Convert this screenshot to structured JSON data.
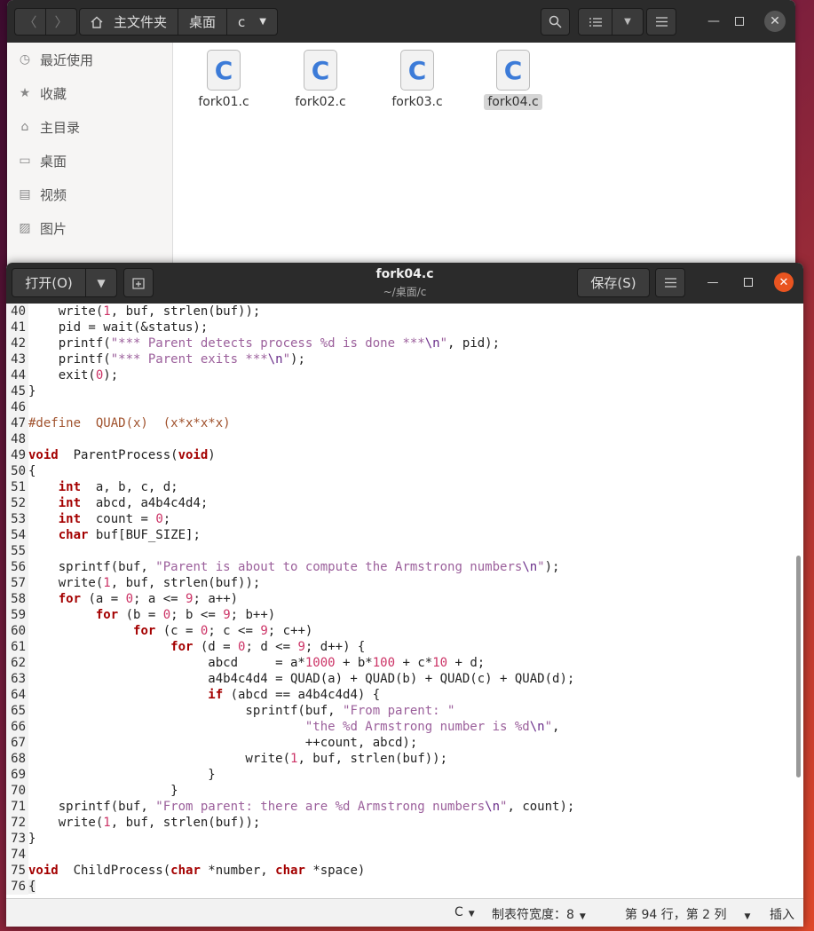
{
  "file_manager": {
    "path": [
      "主文件夹",
      "桌面",
      "c"
    ],
    "sidebar": [
      {
        "icon": "clock-icon",
        "label": "最近使用"
      },
      {
        "icon": "star-icon",
        "label": "收藏"
      },
      {
        "icon": "home-icon",
        "label": "主目录"
      },
      {
        "icon": "desktop-icon",
        "label": "桌面"
      },
      {
        "icon": "video-icon",
        "label": "视频"
      },
      {
        "icon": "picture-icon",
        "label": "图片"
      }
    ],
    "files": [
      {
        "name": "fork01.c",
        "icon_letter": "C"
      },
      {
        "name": "fork02.c",
        "icon_letter": "C"
      },
      {
        "name": "fork03.c",
        "icon_letter": "C"
      },
      {
        "name": "fork04.c",
        "icon_letter": "C",
        "selected": true
      }
    ]
  },
  "editor": {
    "open_label": "打开(O)",
    "title": "fork04.c",
    "subtitle": "~/桌面/c",
    "save_label": "保存(S)",
    "status": {
      "language": "C",
      "tab_width": "制表符宽度：8",
      "position": "第 94 行，第 2 列",
      "mode": "插入"
    },
    "lines": [
      {
        "n": "40",
        "t": "    write(1, buf, strlen(buf));"
      },
      {
        "n": "41",
        "t": "    pid = wait(&status);"
      },
      {
        "n": "42",
        "t": "    printf(\"*** Parent detects process %d is done ***\\n\", pid);"
      },
      {
        "n": "43",
        "t": "    printf(\"*** Parent exits ***\\n\");"
      },
      {
        "n": "44",
        "t": "    exit(0);"
      },
      {
        "n": "45",
        "t": "}"
      },
      {
        "n": "46",
        "t": ""
      },
      {
        "n": "47",
        "t": "#define  QUAD(x)  (x*x*x*x)"
      },
      {
        "n": "48",
        "t": ""
      },
      {
        "n": "49",
        "t": "void  ParentProcess(void)"
      },
      {
        "n": "50",
        "t": "{"
      },
      {
        "n": "51",
        "t": "    int  a, b, c, d;"
      },
      {
        "n": "52",
        "t": "    int  abcd, a4b4c4d4;"
      },
      {
        "n": "53",
        "t": "    int  count = 0;"
      },
      {
        "n": "54",
        "t": "    char buf[BUF_SIZE];"
      },
      {
        "n": "55",
        "t": ""
      },
      {
        "n": "56",
        "t": "    sprintf(buf, \"Parent is about to compute the Armstrong numbers\\n\");"
      },
      {
        "n": "57",
        "t": "    write(1, buf, strlen(buf));"
      },
      {
        "n": "58",
        "t": "    for (a = 0; a <= 9; a++)"
      },
      {
        "n": "59",
        "t": "         for (b = 0; b <= 9; b++)"
      },
      {
        "n": "60",
        "t": "              for (c = 0; c <= 9; c++)"
      },
      {
        "n": "61",
        "t": "                   for (d = 0; d <= 9; d++) {"
      },
      {
        "n": "62",
        "t": "                        abcd     = a*1000 + b*100 + c*10 + d;"
      },
      {
        "n": "63",
        "t": "                        a4b4c4d4 = QUAD(a) + QUAD(b) + QUAD(c) + QUAD(d);"
      },
      {
        "n": "64",
        "t": "                        if (abcd == a4b4c4d4) {"
      },
      {
        "n": "65",
        "t": "                             sprintf(buf, \"From parent: \""
      },
      {
        "n": "66",
        "t": "                                     \"the %d Armstrong number is %d\\n\","
      },
      {
        "n": "67",
        "t": "                                     ++count, abcd);"
      },
      {
        "n": "68",
        "t": "                             write(1, buf, strlen(buf));"
      },
      {
        "n": "69",
        "t": "                        }"
      },
      {
        "n": "70",
        "t": "                   }"
      },
      {
        "n": "71",
        "t": "    sprintf(buf, \"From parent: there are %d Armstrong numbers\\n\", count);"
      },
      {
        "n": "72",
        "t": "    write(1, buf, strlen(buf));"
      },
      {
        "n": "73",
        "t": "}"
      },
      {
        "n": "74",
        "t": ""
      },
      {
        "n": "75",
        "t": "void  ChildProcess(char *number, char *space)"
      },
      {
        "n": "76",
        "t": "{"
      }
    ]
  }
}
